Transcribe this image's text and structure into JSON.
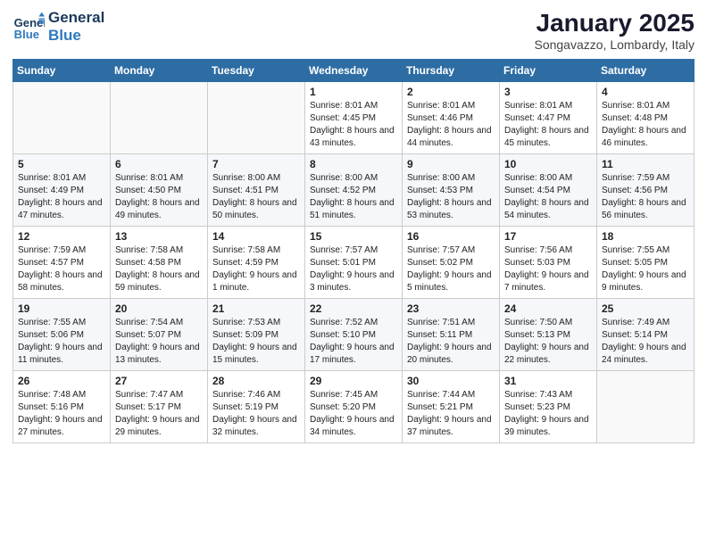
{
  "header": {
    "logo_line1": "General",
    "logo_line2": "Blue",
    "month": "January 2025",
    "location": "Songavazzo, Lombardy, Italy"
  },
  "weekdays": [
    "Sunday",
    "Monday",
    "Tuesday",
    "Wednesday",
    "Thursday",
    "Friday",
    "Saturday"
  ],
  "weeks": [
    [
      {
        "day": "",
        "sunrise": "",
        "sunset": "",
        "daylight": ""
      },
      {
        "day": "",
        "sunrise": "",
        "sunset": "",
        "daylight": ""
      },
      {
        "day": "",
        "sunrise": "",
        "sunset": "",
        "daylight": ""
      },
      {
        "day": "1",
        "sunrise": "Sunrise: 8:01 AM",
        "sunset": "Sunset: 4:45 PM",
        "daylight": "Daylight: 8 hours and 43 minutes."
      },
      {
        "day": "2",
        "sunrise": "Sunrise: 8:01 AM",
        "sunset": "Sunset: 4:46 PM",
        "daylight": "Daylight: 8 hours and 44 minutes."
      },
      {
        "day": "3",
        "sunrise": "Sunrise: 8:01 AM",
        "sunset": "Sunset: 4:47 PM",
        "daylight": "Daylight: 8 hours and 45 minutes."
      },
      {
        "day": "4",
        "sunrise": "Sunrise: 8:01 AM",
        "sunset": "Sunset: 4:48 PM",
        "daylight": "Daylight: 8 hours and 46 minutes."
      }
    ],
    [
      {
        "day": "5",
        "sunrise": "Sunrise: 8:01 AM",
        "sunset": "Sunset: 4:49 PM",
        "daylight": "Daylight: 8 hours and 47 minutes."
      },
      {
        "day": "6",
        "sunrise": "Sunrise: 8:01 AM",
        "sunset": "Sunset: 4:50 PM",
        "daylight": "Daylight: 8 hours and 49 minutes."
      },
      {
        "day": "7",
        "sunrise": "Sunrise: 8:00 AM",
        "sunset": "Sunset: 4:51 PM",
        "daylight": "Daylight: 8 hours and 50 minutes."
      },
      {
        "day": "8",
        "sunrise": "Sunrise: 8:00 AM",
        "sunset": "Sunset: 4:52 PM",
        "daylight": "Daylight: 8 hours and 51 minutes."
      },
      {
        "day": "9",
        "sunrise": "Sunrise: 8:00 AM",
        "sunset": "Sunset: 4:53 PM",
        "daylight": "Daylight: 8 hours and 53 minutes."
      },
      {
        "day": "10",
        "sunrise": "Sunrise: 8:00 AM",
        "sunset": "Sunset: 4:54 PM",
        "daylight": "Daylight: 8 hours and 54 minutes."
      },
      {
        "day": "11",
        "sunrise": "Sunrise: 7:59 AM",
        "sunset": "Sunset: 4:56 PM",
        "daylight": "Daylight: 8 hours and 56 minutes."
      }
    ],
    [
      {
        "day": "12",
        "sunrise": "Sunrise: 7:59 AM",
        "sunset": "Sunset: 4:57 PM",
        "daylight": "Daylight: 8 hours and 58 minutes."
      },
      {
        "day": "13",
        "sunrise": "Sunrise: 7:58 AM",
        "sunset": "Sunset: 4:58 PM",
        "daylight": "Daylight: 8 hours and 59 minutes."
      },
      {
        "day": "14",
        "sunrise": "Sunrise: 7:58 AM",
        "sunset": "Sunset: 4:59 PM",
        "daylight": "Daylight: 9 hours and 1 minute."
      },
      {
        "day": "15",
        "sunrise": "Sunrise: 7:57 AM",
        "sunset": "Sunset: 5:01 PM",
        "daylight": "Daylight: 9 hours and 3 minutes."
      },
      {
        "day": "16",
        "sunrise": "Sunrise: 7:57 AM",
        "sunset": "Sunset: 5:02 PM",
        "daylight": "Daylight: 9 hours and 5 minutes."
      },
      {
        "day": "17",
        "sunrise": "Sunrise: 7:56 AM",
        "sunset": "Sunset: 5:03 PM",
        "daylight": "Daylight: 9 hours and 7 minutes."
      },
      {
        "day": "18",
        "sunrise": "Sunrise: 7:55 AM",
        "sunset": "Sunset: 5:05 PM",
        "daylight": "Daylight: 9 hours and 9 minutes."
      }
    ],
    [
      {
        "day": "19",
        "sunrise": "Sunrise: 7:55 AM",
        "sunset": "Sunset: 5:06 PM",
        "daylight": "Daylight: 9 hours and 11 minutes."
      },
      {
        "day": "20",
        "sunrise": "Sunrise: 7:54 AM",
        "sunset": "Sunset: 5:07 PM",
        "daylight": "Daylight: 9 hours and 13 minutes."
      },
      {
        "day": "21",
        "sunrise": "Sunrise: 7:53 AM",
        "sunset": "Sunset: 5:09 PM",
        "daylight": "Daylight: 9 hours and 15 minutes."
      },
      {
        "day": "22",
        "sunrise": "Sunrise: 7:52 AM",
        "sunset": "Sunset: 5:10 PM",
        "daylight": "Daylight: 9 hours and 17 minutes."
      },
      {
        "day": "23",
        "sunrise": "Sunrise: 7:51 AM",
        "sunset": "Sunset: 5:11 PM",
        "daylight": "Daylight: 9 hours and 20 minutes."
      },
      {
        "day": "24",
        "sunrise": "Sunrise: 7:50 AM",
        "sunset": "Sunset: 5:13 PM",
        "daylight": "Daylight: 9 hours and 22 minutes."
      },
      {
        "day": "25",
        "sunrise": "Sunrise: 7:49 AM",
        "sunset": "Sunset: 5:14 PM",
        "daylight": "Daylight: 9 hours and 24 minutes."
      }
    ],
    [
      {
        "day": "26",
        "sunrise": "Sunrise: 7:48 AM",
        "sunset": "Sunset: 5:16 PM",
        "daylight": "Daylight: 9 hours and 27 minutes."
      },
      {
        "day": "27",
        "sunrise": "Sunrise: 7:47 AM",
        "sunset": "Sunset: 5:17 PM",
        "daylight": "Daylight: 9 hours and 29 minutes."
      },
      {
        "day": "28",
        "sunrise": "Sunrise: 7:46 AM",
        "sunset": "Sunset: 5:19 PM",
        "daylight": "Daylight: 9 hours and 32 minutes."
      },
      {
        "day": "29",
        "sunrise": "Sunrise: 7:45 AM",
        "sunset": "Sunset: 5:20 PM",
        "daylight": "Daylight: 9 hours and 34 minutes."
      },
      {
        "day": "30",
        "sunrise": "Sunrise: 7:44 AM",
        "sunset": "Sunset: 5:21 PM",
        "daylight": "Daylight: 9 hours and 37 minutes."
      },
      {
        "day": "31",
        "sunrise": "Sunrise: 7:43 AM",
        "sunset": "Sunset: 5:23 PM",
        "daylight": "Daylight: 9 hours and 39 minutes."
      },
      {
        "day": "",
        "sunrise": "",
        "sunset": "",
        "daylight": ""
      }
    ]
  ]
}
